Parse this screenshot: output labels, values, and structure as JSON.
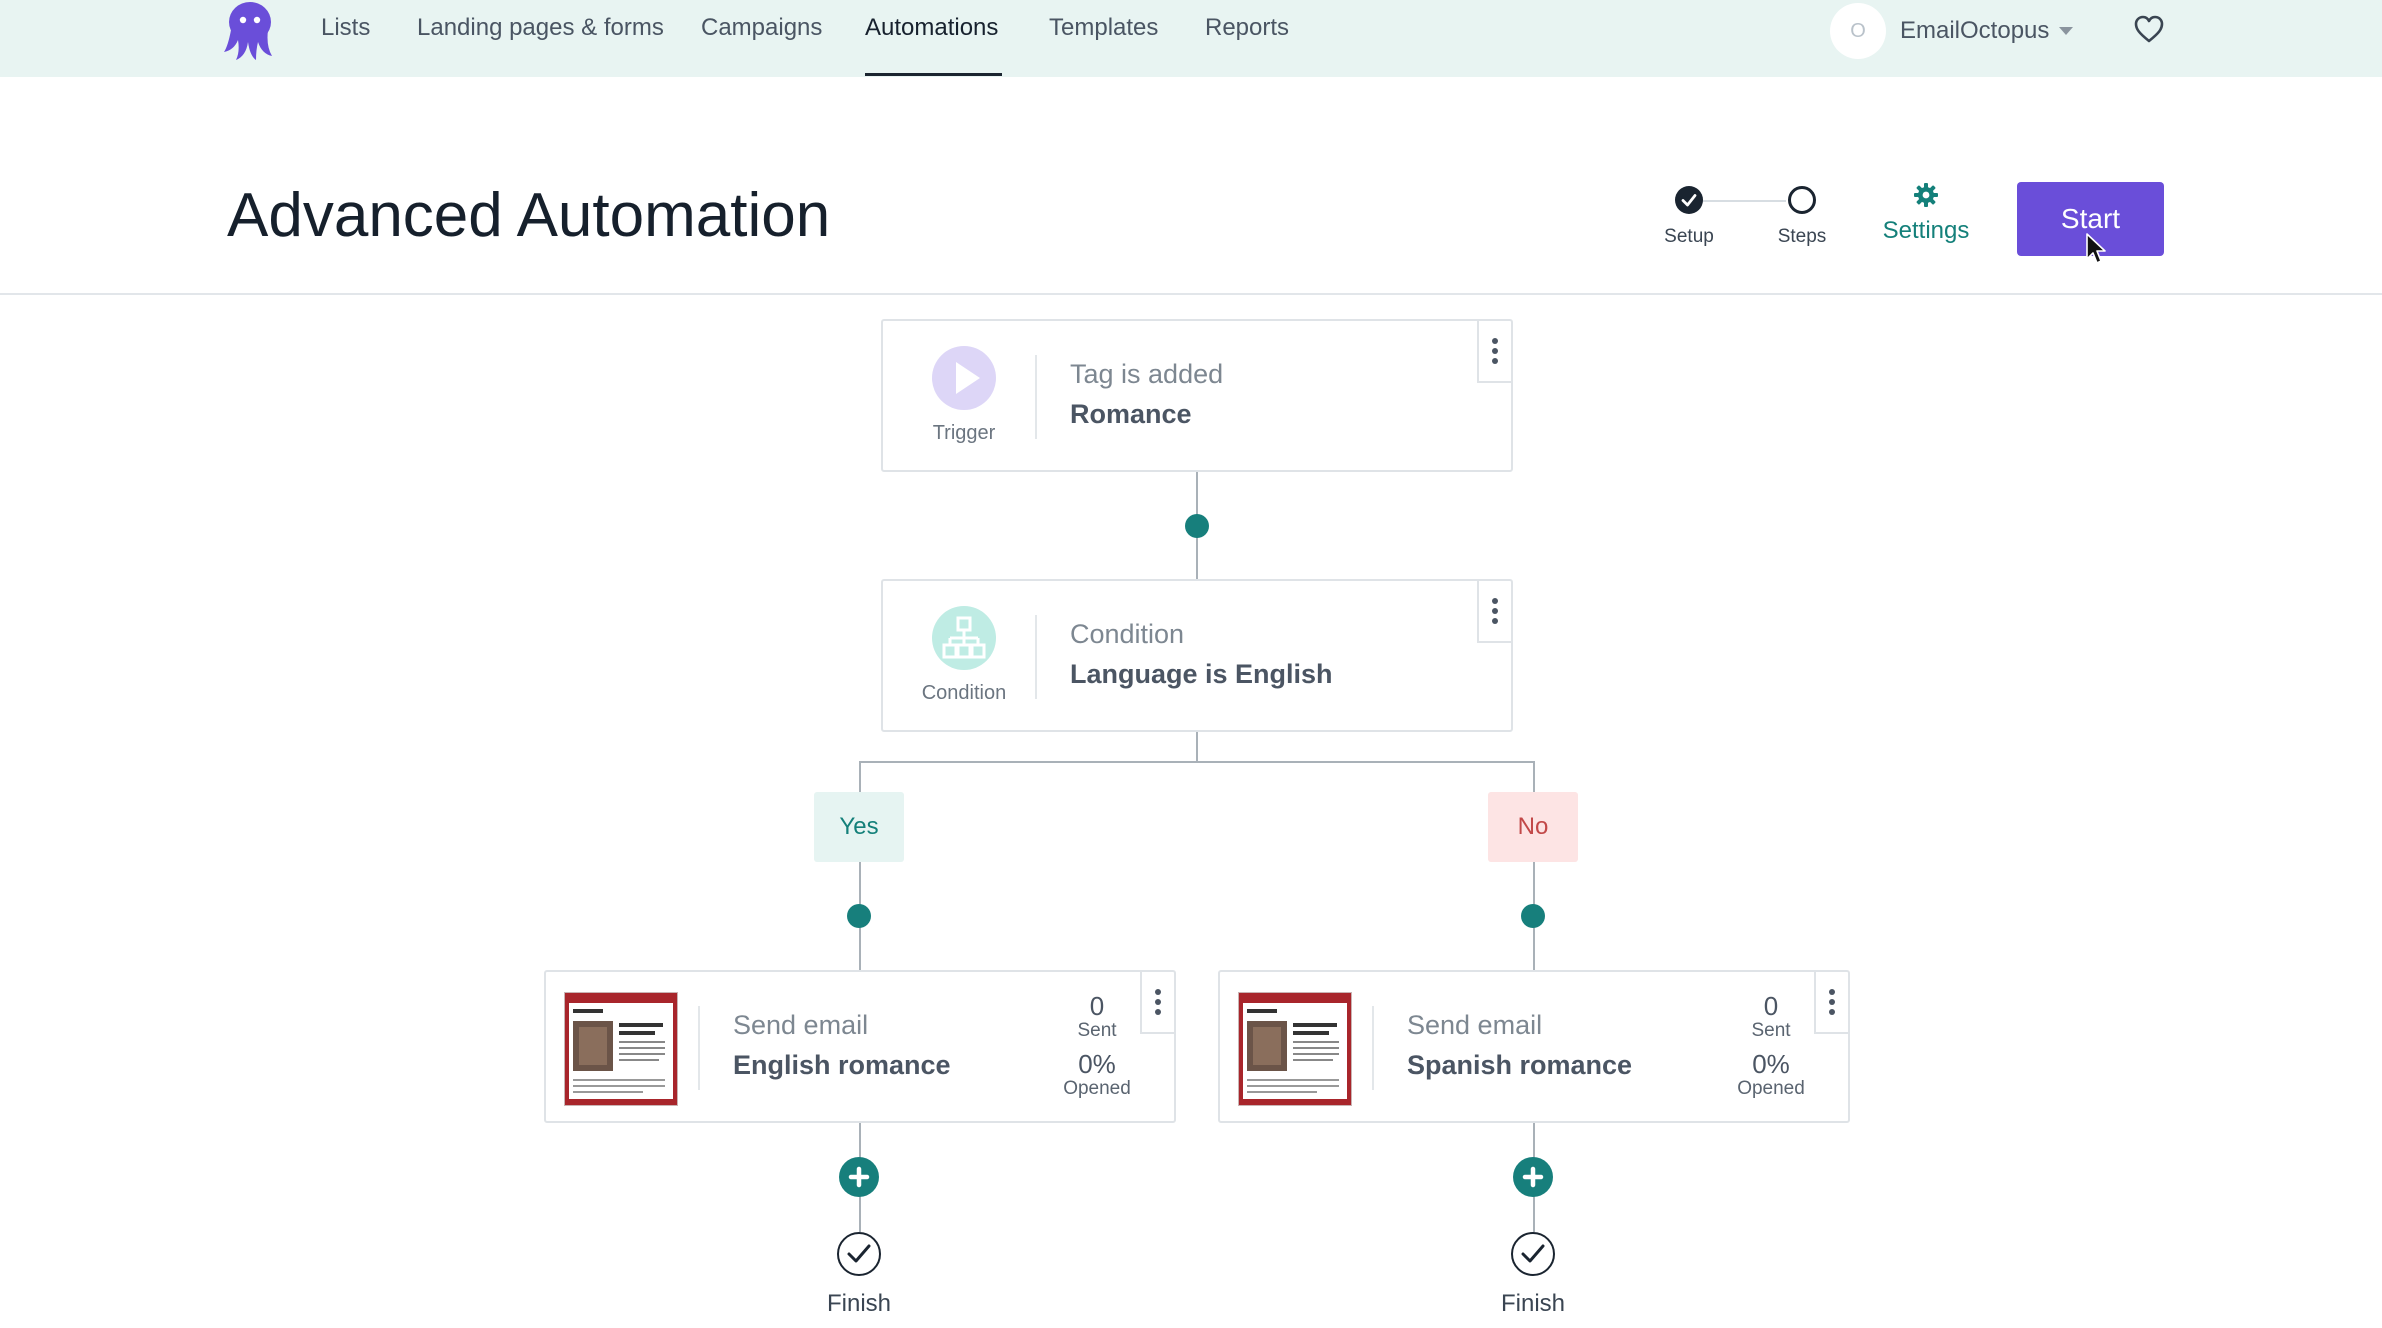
{
  "nav": {
    "items": [
      "Lists",
      "Landing pages & forms",
      "Campaigns",
      "Automations",
      "Templates",
      "Reports"
    ],
    "active": "Automations",
    "account": {
      "avatar_initial": "O",
      "name": "EmailOctopus"
    }
  },
  "header": {
    "title": "Advanced Automation",
    "steps": [
      {
        "label": "Setup",
        "state": "complete"
      },
      {
        "label": "Steps",
        "state": "current"
      }
    ],
    "settings_label": "Settings",
    "start_label": "Start"
  },
  "flow": {
    "trigger": {
      "icon_label": "Trigger",
      "title": "Tag is added",
      "value": "Romance"
    },
    "condition": {
      "icon_label": "Condition",
      "title": "Condition",
      "value": "Language is English"
    },
    "branches": {
      "yes": {
        "label": "Yes",
        "email": {
          "title": "Send email",
          "name": "English romance",
          "sent": "0",
          "sent_label": "Sent",
          "opened": "0%",
          "opened_label": "Opened"
        },
        "finish_label": "Finish"
      },
      "no": {
        "label": "No",
        "email": {
          "title": "Send email",
          "name": "Spanish romance",
          "sent": "0",
          "sent_label": "Sent",
          "opened": "0%",
          "opened_label": "Opened"
        },
        "finish_label": "Finish"
      }
    }
  },
  "colors": {
    "accent_teal": "#177f7c",
    "primary_button": "#6a4ed9",
    "nav_background": "#e8f4f2",
    "yes_background": "#e6f4f2",
    "no_background": "#fde4e4",
    "no_text": "#c24848"
  },
  "icons": {
    "logo": "octopus-logo-icon",
    "favorite": "heart-icon",
    "settings": "gear-icon",
    "trigger": "play-icon",
    "condition": "split-icon",
    "menu": "kebab-menu-icon",
    "add": "plus-circle-icon",
    "finish": "check-circle-icon"
  }
}
